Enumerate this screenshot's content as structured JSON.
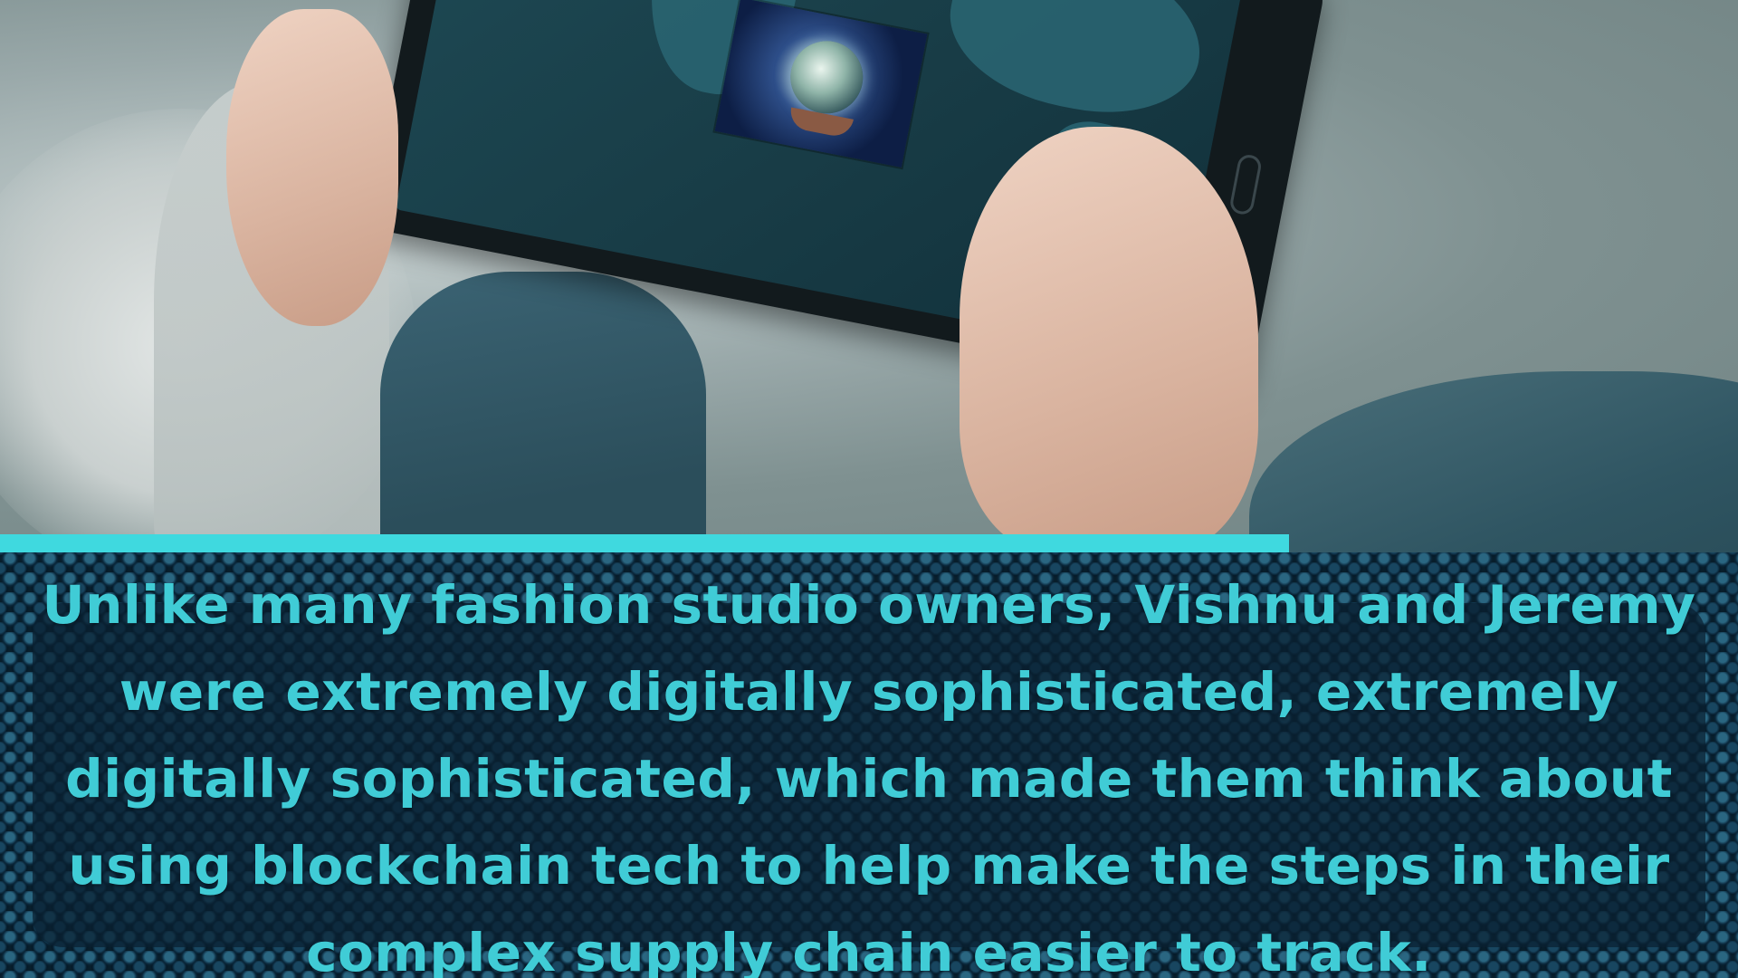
{
  "caption": {
    "lines": [
      "Unlike many fashion studio owners, Vishnu and Jeremy",
      "were extremely digitally sophisticated, extremely",
      "digitally sophisticated,  which made them think about",
      "using blockchain tech to help make the steps in their",
      "complex supply chain easier to track."
    ]
  },
  "colors": {
    "accent": "#3fd9df",
    "caption_text": "#40ccd6",
    "caption_background": "#081e2b"
  }
}
